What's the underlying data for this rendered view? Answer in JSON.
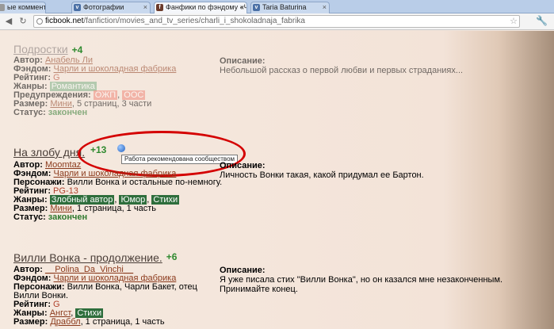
{
  "browser": {
    "tabs": [
      {
        "label": "ые комментарии",
        "icon": "page-icon"
      },
      {
        "label": "Фотографии",
        "icon": "vk-icon"
      },
      {
        "label": "Фанфики по фэндому «Ча",
        "icon": "ficbook-icon"
      },
      {
        "label": "Taria Baturina",
        "icon": "vk-icon"
      }
    ],
    "url_host": "ficbook.net",
    "url_path": "/fanfiction/movies_and_tv_series/charli_i_shokoladnaja_fabrika"
  },
  "labels": {
    "author": "Автор:",
    "fandom": "Фэндом:",
    "characters": "Персонажи:",
    "rating": "Рейтинг:",
    "genres": "Жанры:",
    "warnings": "Предупреждения:",
    "size": "Размер:",
    "status": "Статус:",
    "description": "Описание:"
  },
  "entries": [
    {
      "title": "Подростки",
      "score": "+4",
      "author": "Анабель Ли",
      "fandom": "Чарли и шоколадная фабрика",
      "rating": "G",
      "genres": [
        "Романтика"
      ],
      "warnings": [
        "ОЖП",
        "ООС"
      ],
      "size_link": "Мини",
      "size_rest": ", 5 страниц, 3 части",
      "status": "закончен",
      "description": "Небольшой рассказ о первой любви и первых страданиях..."
    },
    {
      "title": "На злобу дня.",
      "score": "+13",
      "tooltip": "Работа рекомендована сообществом",
      "author": "Moomtaz",
      "fandom": "Чарли и шоколадная фабрика",
      "characters": "Вилли Вонка и остальные по-немногу.",
      "rating": "PG-13",
      "genres": [
        "Злобный автор",
        "Юмор",
        "Стихи"
      ],
      "size_link": "Мини",
      "size_rest": ", 1 страница, 1 часть",
      "status": "закончен",
      "description": "Личность Вонки такая, какой придумал ее Бартон."
    },
    {
      "title": "Вилли Вонка - продолжение.",
      "score": "+6",
      "author": "__Polina_Da_Vinchi__",
      "fandom": "Чарли и шоколадная фабрика",
      "characters_line1": "Вилли Вонка, Чарли Бакет, отец",
      "characters_line2": "Вилли Вонки.",
      "rating": "G",
      "genres": [
        "Ангст",
        "Стихи"
      ],
      "size_link": "Драббл",
      "size_rest": ", 1 страница, 1 часть",
      "description_line1": "Я уже писала стих \"Вилли Вонка\", но он казался мне незаконченным.",
      "description_line2": "Принимайте конец."
    }
  ],
  "sep": ", "
}
